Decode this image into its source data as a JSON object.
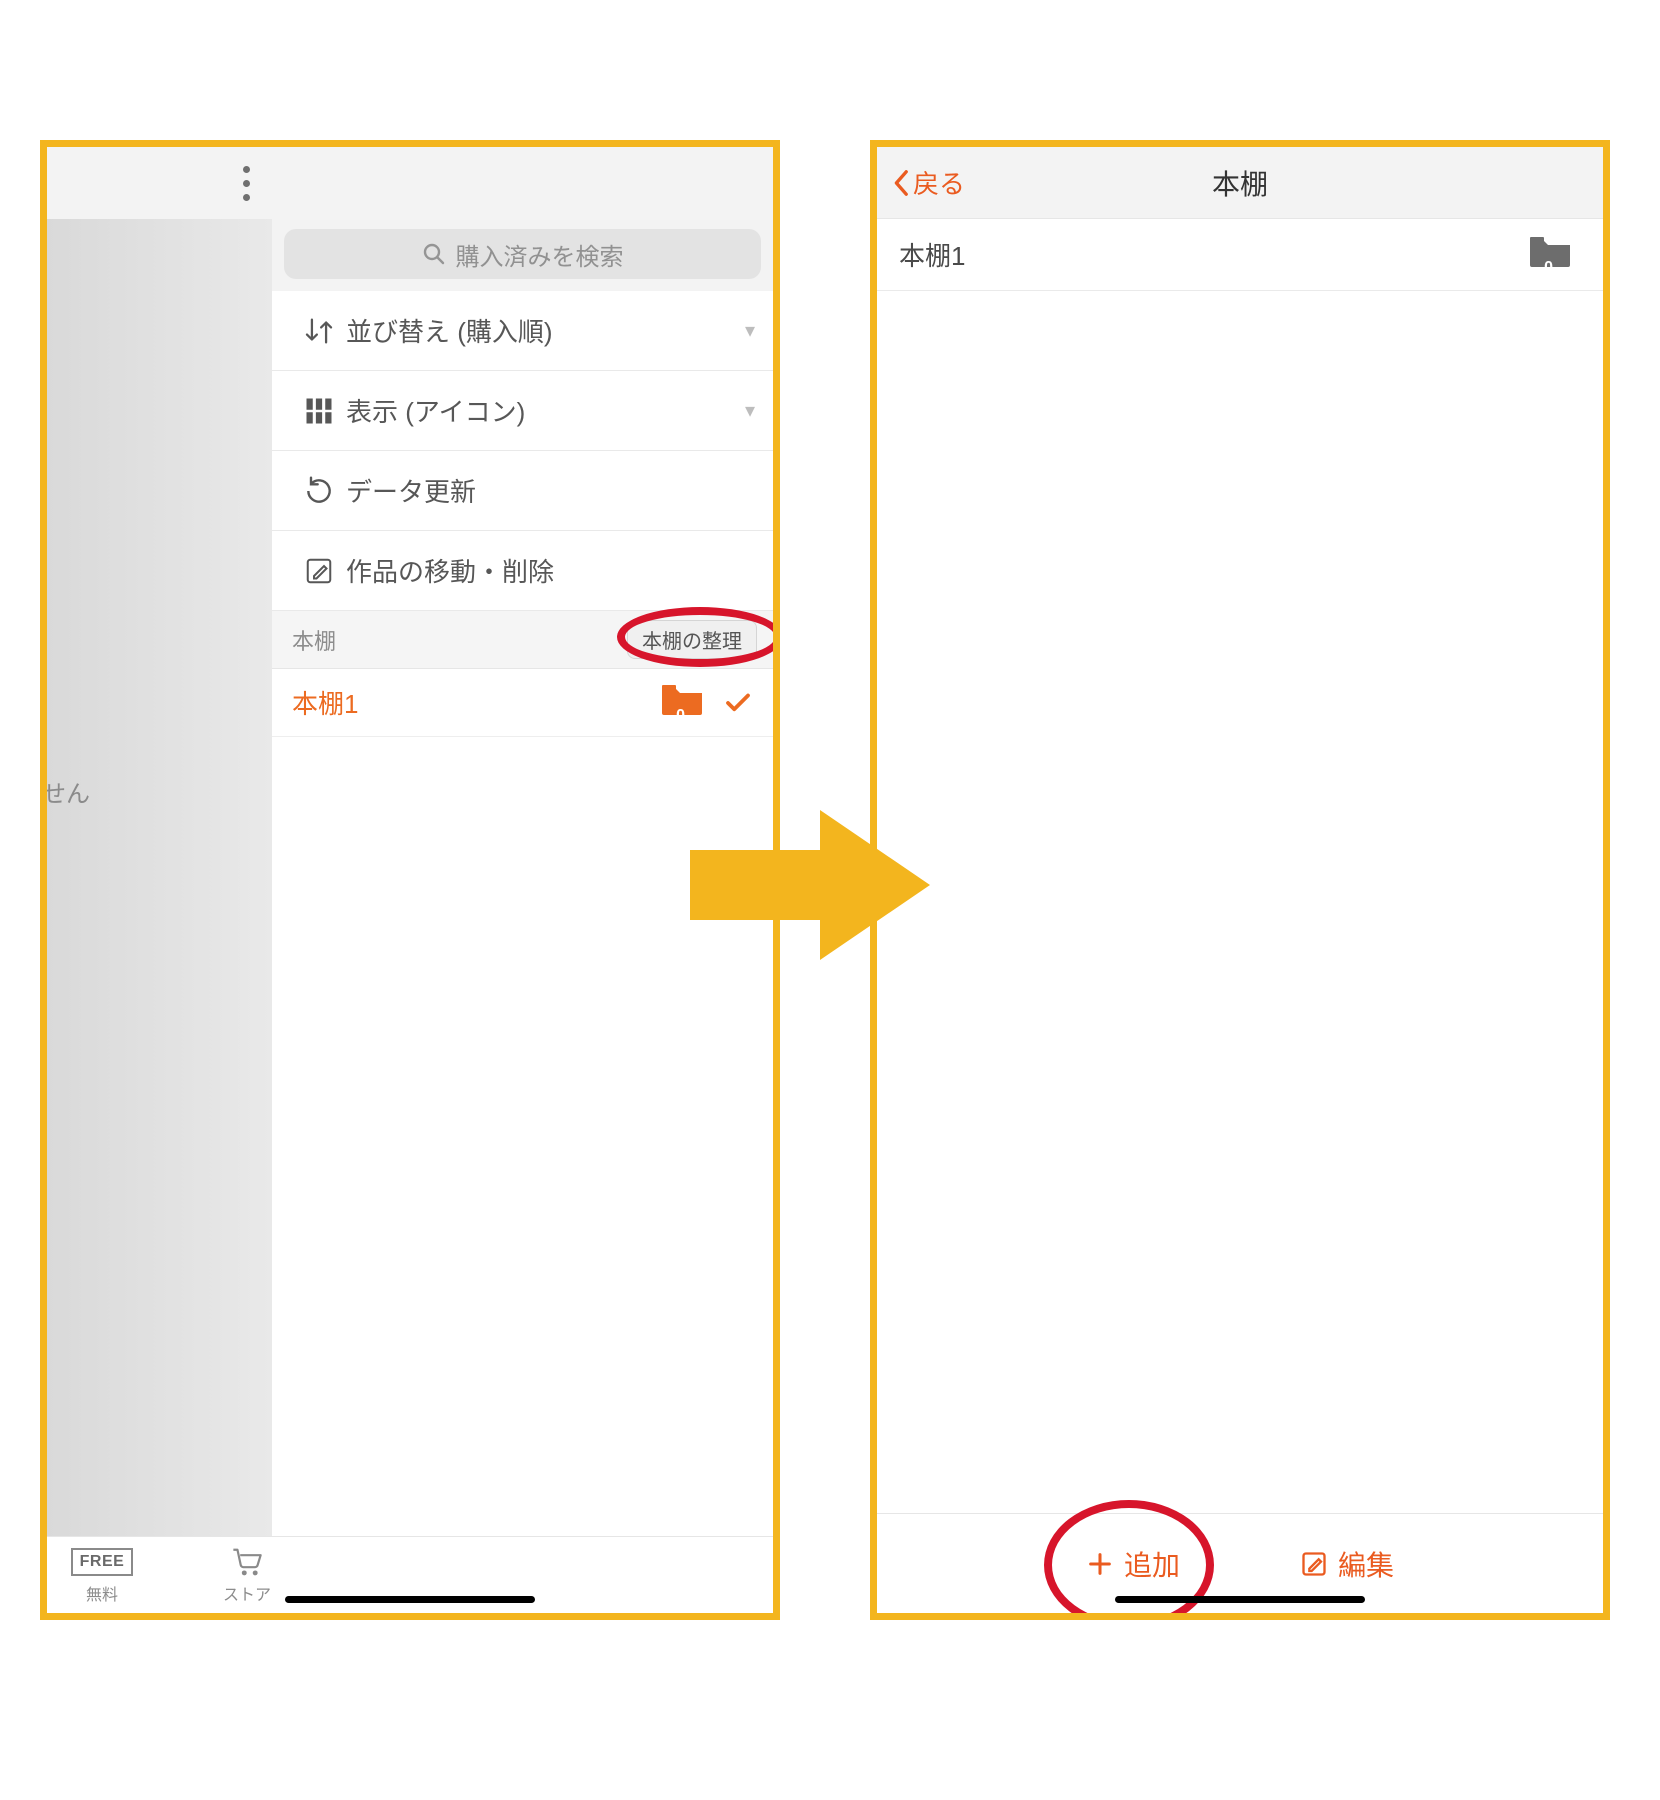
{
  "left": {
    "search_placeholder": "購入済みを検索",
    "menu": {
      "sort": {
        "label": "並び替え (購入順)"
      },
      "view": {
        "label": "表示 (アイコン)"
      },
      "refresh": {
        "label": "データ更新"
      },
      "move": {
        "label": "作品の移動・削除"
      }
    },
    "section_label": "本棚",
    "organize_btn": "本棚の整理",
    "shelves": [
      {
        "name": "本棚1",
        "count": "0"
      }
    ],
    "strip_text": "せん",
    "tabs": {
      "free": "無料",
      "free_icon_label": "FREE",
      "store": "ストア"
    }
  },
  "right": {
    "back": "戻る",
    "title": "本棚",
    "rows": [
      {
        "name": "本棚1",
        "count": "0"
      }
    ],
    "add": "追加",
    "edit": "編集"
  }
}
